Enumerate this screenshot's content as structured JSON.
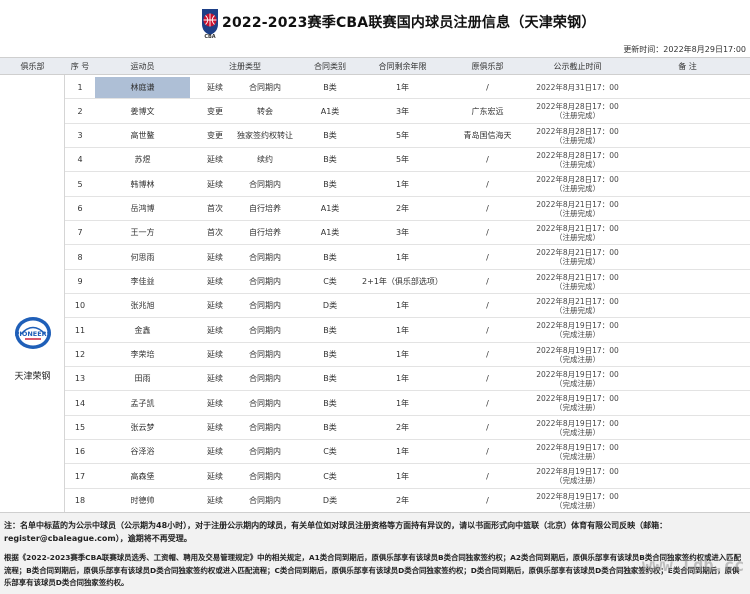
{
  "title": "2022-2023赛季CBA联赛国内球员注册信息（天津荣钢）",
  "logo_text": "CBA",
  "update_time": "更新时间：2022年8月29日17:00",
  "columns": {
    "club": "俱乐部",
    "seq": "序 号",
    "player": "运动员",
    "reg_type": "注册类型",
    "contract_class": "合同类别",
    "years_left": "合同剩余年限",
    "orig_club": "原俱乐部",
    "deadline": "公示截止时间",
    "remarks": "备 注"
  },
  "club": {
    "name": "天津荣钢",
    "logo_text": "PIONEERS"
  },
  "rows": [
    {
      "seq": "1",
      "name": "林庭谦",
      "type1": "延续",
      "type2": "合同期内",
      "cls": "B类",
      "years": "1年",
      "orig": "/",
      "d1": "2022年8月31日17：00",
      "d2": ""
    },
    {
      "seq": "2",
      "name": "姜博文",
      "type1": "变更",
      "type2": "转会",
      "cls": "A1类",
      "years": "3年",
      "orig": "广东宏远",
      "d1": "2022年8月28日17：00",
      "d2": "（注册完成）"
    },
    {
      "seq": "3",
      "name": "高世鳌",
      "type1": "变更",
      "type2": "独家签约权转让",
      "cls": "B类",
      "years": "5年",
      "orig": "青岛国信海天",
      "d1": "2022年8月28日17：00",
      "d2": "（注册完成）"
    },
    {
      "seq": "4",
      "name": "苏煜",
      "type1": "延续",
      "type2": "续约",
      "cls": "B类",
      "years": "5年",
      "orig": "/",
      "d1": "2022年8月28日17：00",
      "d2": "（注册完成）"
    },
    {
      "seq": "5",
      "name": "韩博林",
      "type1": "延续",
      "type2": "合同期内",
      "cls": "B类",
      "years": "1年",
      "orig": "/",
      "d1": "2022年8月28日17：00",
      "d2": "（注册完成）"
    },
    {
      "seq": "6",
      "name": "岳鸿博",
      "type1": "首次",
      "type2": "自行培养",
      "cls": "A1类",
      "years": "2年",
      "orig": "/",
      "d1": "2022年8月21日17：00",
      "d2": "（注册完成）"
    },
    {
      "seq": "7",
      "name": "王一方",
      "type1": "首次",
      "type2": "自行培养",
      "cls": "A1类",
      "years": "3年",
      "orig": "/",
      "d1": "2022年8月21日17：00",
      "d2": "（注册完成）"
    },
    {
      "seq": "8",
      "name": "何思雨",
      "type1": "延续",
      "type2": "合同期内",
      "cls": "B类",
      "years": "1年",
      "orig": "/",
      "d1": "2022年8月21日17：00",
      "d2": "（注册完成）"
    },
    {
      "seq": "9",
      "name": "李佳益",
      "type1": "延续",
      "type2": "合同期内",
      "cls": "C类",
      "years": "2+1年（俱乐部选项）",
      "orig": "/",
      "d1": "2022年8月21日17：00",
      "d2": "（注册完成）"
    },
    {
      "seq": "10",
      "name": "张兆旭",
      "type1": "延续",
      "type2": "合同期内",
      "cls": "D类",
      "years": "1年",
      "orig": "/",
      "d1": "2022年8月21日17：00",
      "d2": "（注册完成）"
    },
    {
      "seq": "11",
      "name": "金鑫",
      "type1": "延续",
      "type2": "合同期内",
      "cls": "B类",
      "years": "1年",
      "orig": "/",
      "d1": "2022年8月19日17：00",
      "d2": "（完成注册）"
    },
    {
      "seq": "12",
      "name": "李荣培",
      "type1": "延续",
      "type2": "合同期内",
      "cls": "B类",
      "years": "1年",
      "orig": "/",
      "d1": "2022年8月19日17：00",
      "d2": "（完成注册）"
    },
    {
      "seq": "13",
      "name": "田雨",
      "type1": "延续",
      "type2": "合同期内",
      "cls": "B类",
      "years": "1年",
      "orig": "/",
      "d1": "2022年8月19日17：00",
      "d2": "（完成注册）"
    },
    {
      "seq": "14",
      "name": "孟子凯",
      "type1": "延续",
      "type2": "合同期内",
      "cls": "B类",
      "years": "1年",
      "orig": "/",
      "d1": "2022年8月19日17：00",
      "d2": "（完成注册）"
    },
    {
      "seq": "15",
      "name": "张云梦",
      "type1": "延续",
      "type2": "合同期内",
      "cls": "B类",
      "years": "2年",
      "orig": "/",
      "d1": "2022年8月19日17：00",
      "d2": "（完成注册）"
    },
    {
      "seq": "16",
      "name": "谷泽浴",
      "type1": "延续",
      "type2": "合同期内",
      "cls": "C类",
      "years": "1年",
      "orig": "/",
      "d1": "2022年8月19日17：00",
      "d2": "（完成注册）"
    },
    {
      "seq": "17",
      "name": "高森堡",
      "type1": "延续",
      "type2": "合同期内",
      "cls": "C类",
      "years": "1年",
      "orig": "/",
      "d1": "2022年8月19日17：00",
      "d2": "（完成注册）"
    },
    {
      "seq": "18",
      "name": "时德帅",
      "type1": "延续",
      "type2": "合同期内",
      "cls": "D类",
      "years": "2年",
      "orig": "/",
      "d1": "2022年8月19日17：00",
      "d2": "（完成注册）"
    }
  ],
  "note1": "注：名单中标蓝的为公示中球员（公示期为48小时），对于注册公示期内的球员，有关单位如对球员注册资格等方面持有异议的，请以书面形式向中篮联（北京）体育有限公司反映（邮箱：register@cbaleague.com），逾期将不再受理。",
  "note2": "根据《2022-2023赛季CBA联赛球员选秀、工资帽、聘用及交易管理规定》中的相关规定，A1类合同到期后，原俱乐部享有该球员B类合同独家签约权；A2类合同到期后，原俱乐部享有该球员B类合同独家签约权或进入匹配流程；B类合同到期后，原俱乐部享有该球员D类合同独家签约权或进入匹配流程；C类合同到期后，原俱乐部享有该球员D类合同独家签约权；D类合同到期后，原俱乐部享有该球员D类合同独家签约权；E类合同到期后，原俱乐部享有该球员D类合同独家签约权。",
  "watermark": "www.Ldb.cc",
  "colors": {
    "highlight": "#aebfd6",
    "header_bg": "#e9ecf1",
    "note_bg": "#f2f2f2",
    "cba_red": "#c8102e",
    "cba_blue": "#1d3f87",
    "pioneers_blue": "#1f5fb8"
  }
}
